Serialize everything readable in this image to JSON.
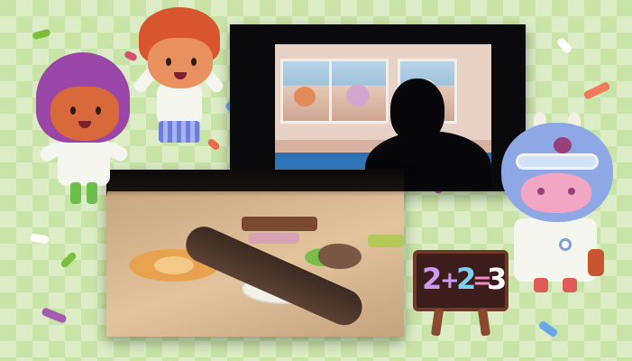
{
  "scene": {
    "background_color": "#c9e4a7",
    "photos": [
      {
        "subject": "child-watching-projected-screen"
      },
      {
        "subject": "interactive-projection-table"
      }
    ],
    "characters": [
      {
        "name": "purple-hair-child",
        "hair_color": "#9a45a8"
      },
      {
        "name": "orange-hair-child",
        "hair_color": "#d9552d"
      },
      {
        "name": "blue-cow-scientist",
        "body_color": "#8ea8e6"
      }
    ],
    "chalkboard": {
      "digit_1": "2",
      "plus": "+",
      "digit_2": "2",
      "equals": "=",
      "result": "3",
      "colors": {
        "digit_1": "#c89cf0",
        "digit_2": "#7ed0f0",
        "equals": "#f08cc0",
        "result": "#ffffff"
      }
    }
  }
}
